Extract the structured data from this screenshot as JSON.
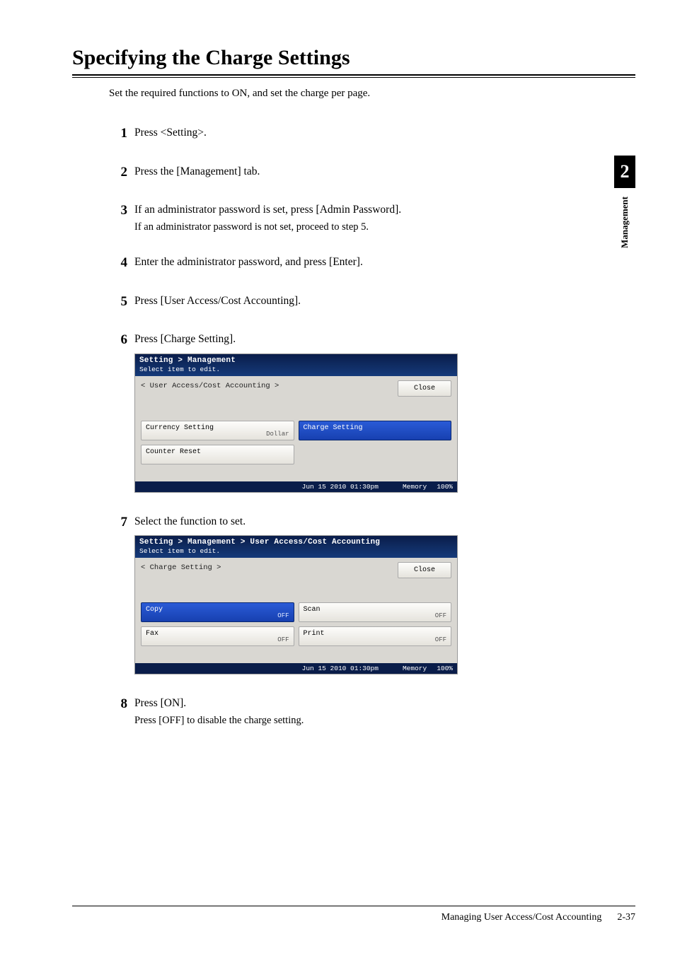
{
  "side_tab": {
    "chapter": "2",
    "label": "Management"
  },
  "title": "Specifying the Charge Settings",
  "intro": "Set the required functions to ON, and set the charge per page.",
  "steps": {
    "s1": {
      "num": "1",
      "text": "Press <Setting>."
    },
    "s2": {
      "num": "2",
      "text": "Press the [Management] tab."
    },
    "s3": {
      "num": "3",
      "text": "If an administrator password is set, press [Admin Password].",
      "sub": "If an administrator password is not set, proceed to step 5."
    },
    "s4": {
      "num": "4",
      "text": "Enter the administrator password, and press [Enter]."
    },
    "s5": {
      "num": "5",
      "text": "Press [User Access/Cost Accounting]."
    },
    "s6": {
      "num": "6",
      "text": "Press [Charge Setting]."
    },
    "s7": {
      "num": "7",
      "text": "Select the function to set."
    },
    "s8": {
      "num": "8",
      "text": "Press [ON].",
      "sub": "Press [OFF] to disable the charge setting."
    }
  },
  "panel1": {
    "breadcrumb": "Setting > Management",
    "hint": "Select item to edit.",
    "subtitle": "< User Access/Cost Accounting >",
    "close": "Close",
    "buttons": {
      "currency": {
        "label": "Currency Setting",
        "value": "Dollar"
      },
      "charge": {
        "label": "Charge Setting"
      },
      "counter": {
        "label": "Counter Reset"
      }
    },
    "status": {
      "timestamp": "Jun 15 2010 01:30pm",
      "mem_label": "Memory",
      "mem_value": "100%"
    }
  },
  "panel2": {
    "breadcrumb": "Setting > Management > User Access/Cost Accounting",
    "hint": "Select item to edit.",
    "subtitle": "< Charge Setting >",
    "close": "Close",
    "buttons": {
      "copy": {
        "label": "Copy",
        "value": "OFF"
      },
      "scan": {
        "label": "Scan",
        "value": "OFF"
      },
      "fax": {
        "label": "Fax",
        "value": "OFF"
      },
      "print": {
        "label": "Print",
        "value": "OFF"
      }
    },
    "status": {
      "timestamp": "Jun 15 2010 01:30pm",
      "mem_label": "Memory",
      "mem_value": "100%"
    }
  },
  "footer": {
    "section": "Managing User Access/Cost Accounting",
    "page": "2-37"
  }
}
